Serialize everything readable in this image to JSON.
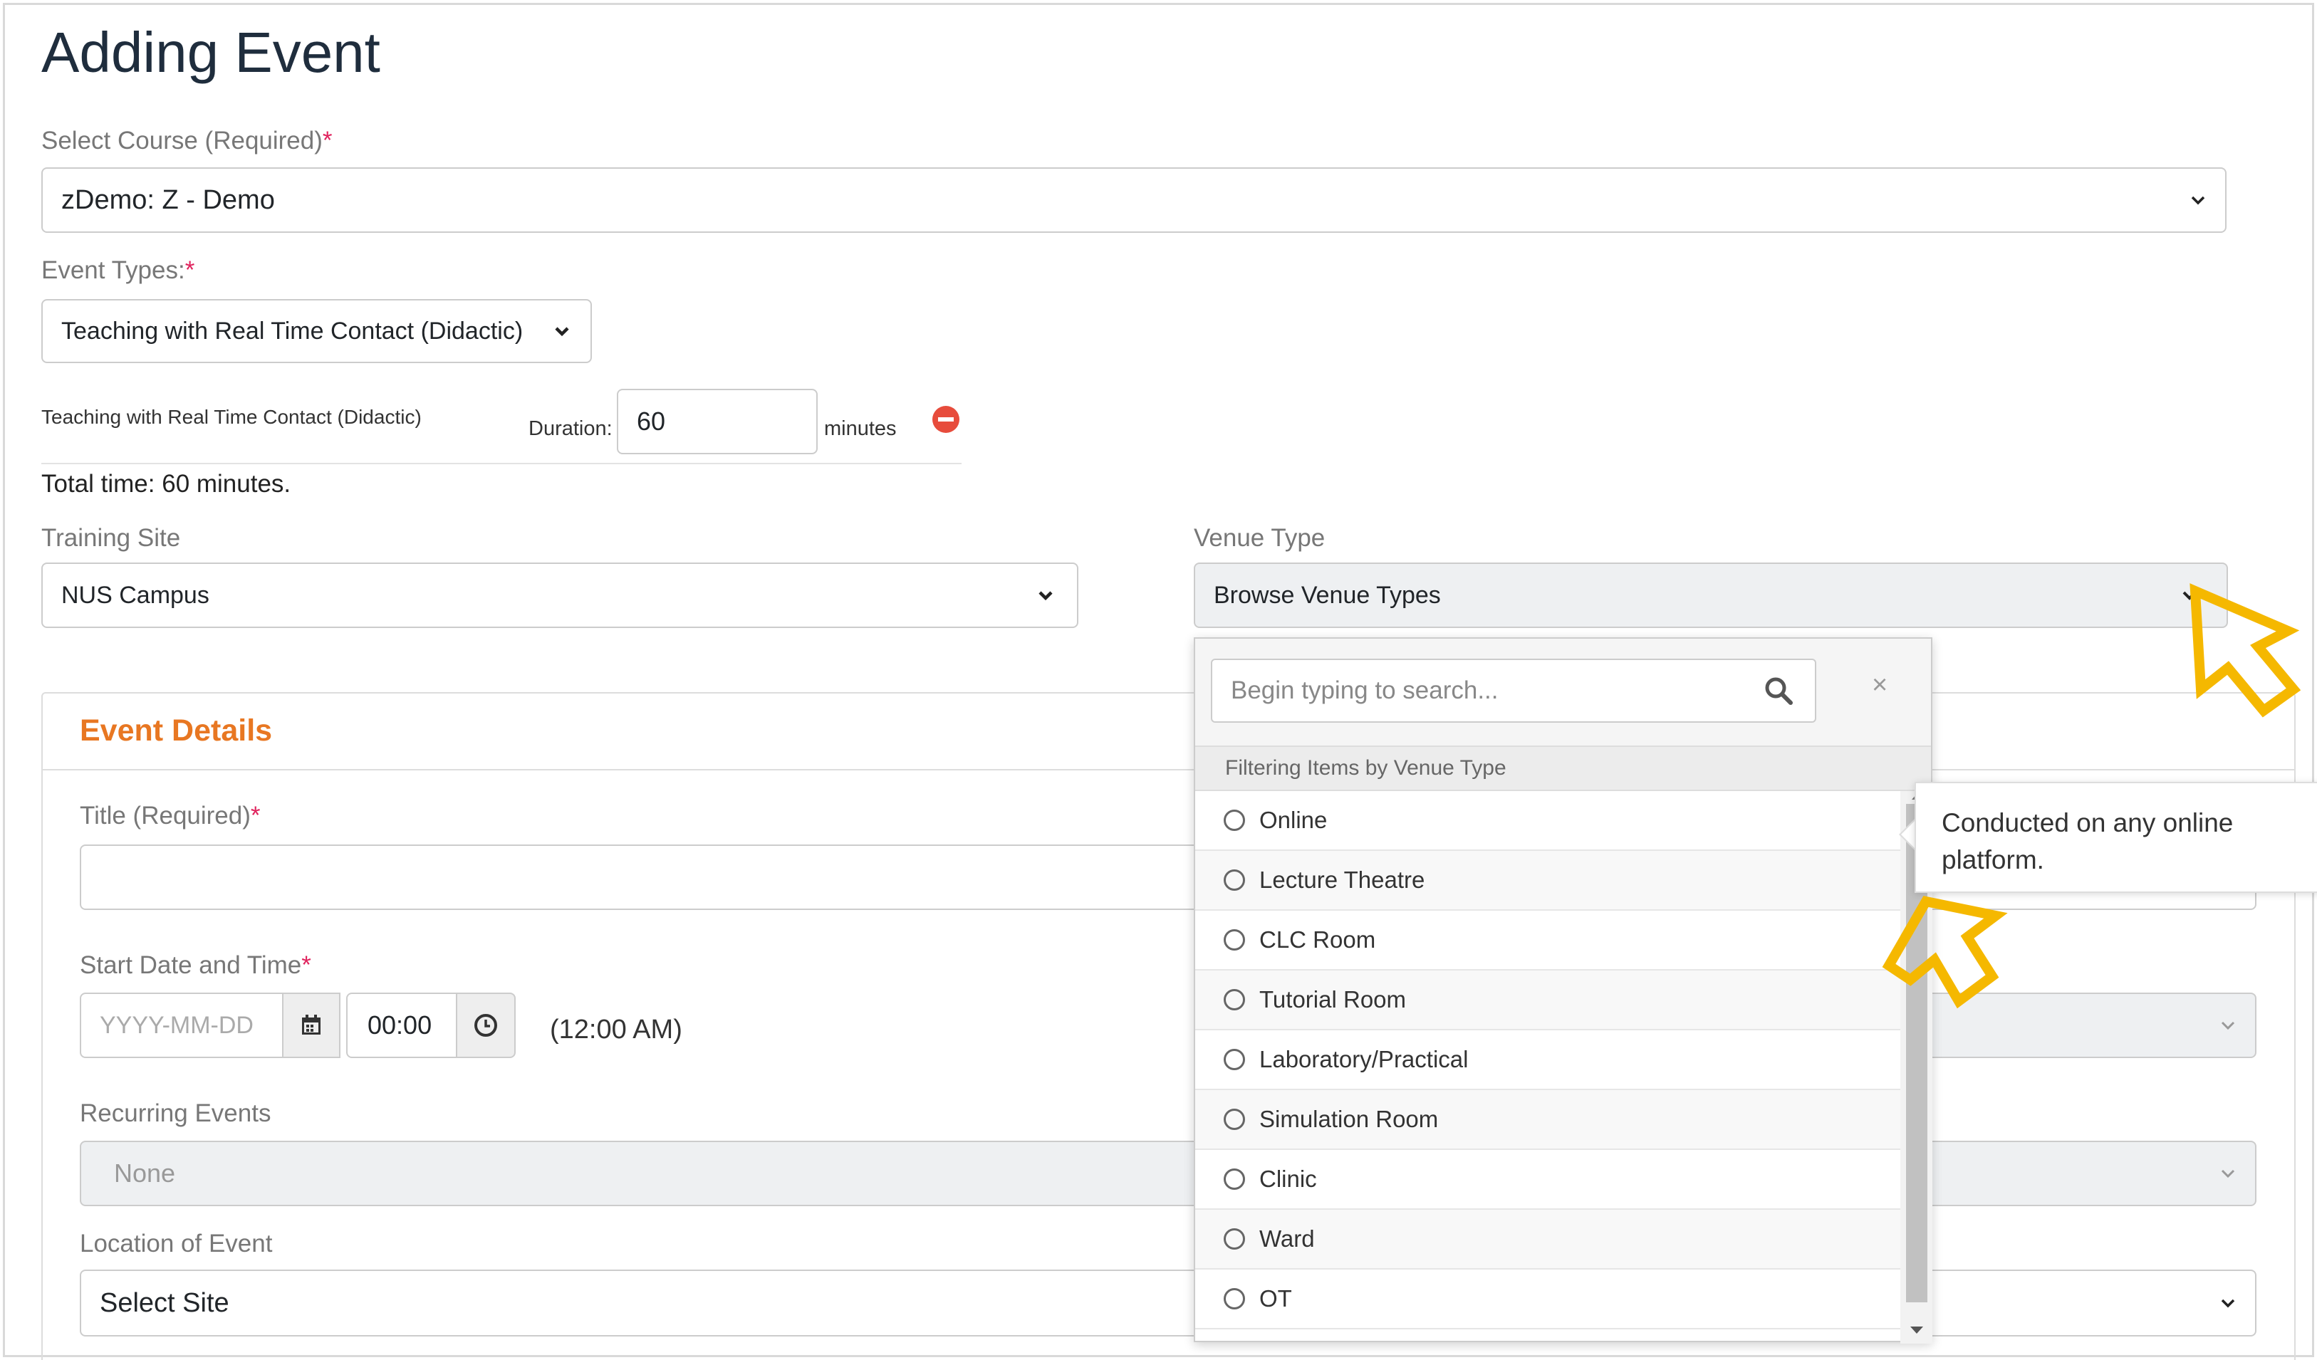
{
  "page": {
    "title": "Adding Event"
  },
  "course": {
    "label": "Select Course (Required)",
    "required_mark": "*",
    "value": "zDemo: Z - Demo"
  },
  "event_types": {
    "label": "Event Types:",
    "required_mark": "*",
    "value": "Teaching with Real Time Contact (Didactic)"
  },
  "duration_row": {
    "event_type": "Teaching with Real Time Contact (Didactic)",
    "duration_label": "Duration:",
    "duration_value": "60",
    "unit": "minutes"
  },
  "total_time": "Total time: 60 minutes.",
  "training_site": {
    "label": "Training Site",
    "value": "NUS Campus"
  },
  "venue_type": {
    "label": "Venue Type",
    "value": "Browse Venue Types",
    "search_placeholder": "Begin typing to search...",
    "clear_symbol": "×",
    "header": "Filtering Items by Venue Type",
    "options": [
      "Online",
      "Lecture Theatre",
      "CLC Room",
      "Tutorial Room",
      "Laboratory/Practical",
      "Simulation Room",
      "Clinic",
      "Ward",
      "OT"
    ],
    "tooltip": "Conducted on any online platform."
  },
  "event_details": {
    "heading": "Event Details",
    "title_label": "Title (Required)",
    "title_required_mark": "*",
    "start_label": "Start Date and Time",
    "start_required_mark": "*",
    "date_placeholder": "YYYY-MM-DD",
    "time_value": "00:00",
    "time_display": "(12:00 AM)",
    "recurring_label": "Recurring Events",
    "recurring_value": "None",
    "location_label": "Location of Event",
    "location_value": "Select Site"
  },
  "colors": {
    "accent": "#e87722",
    "required": "#e0245e",
    "annotation": "#f5b800",
    "remove": "#e74c3c"
  }
}
